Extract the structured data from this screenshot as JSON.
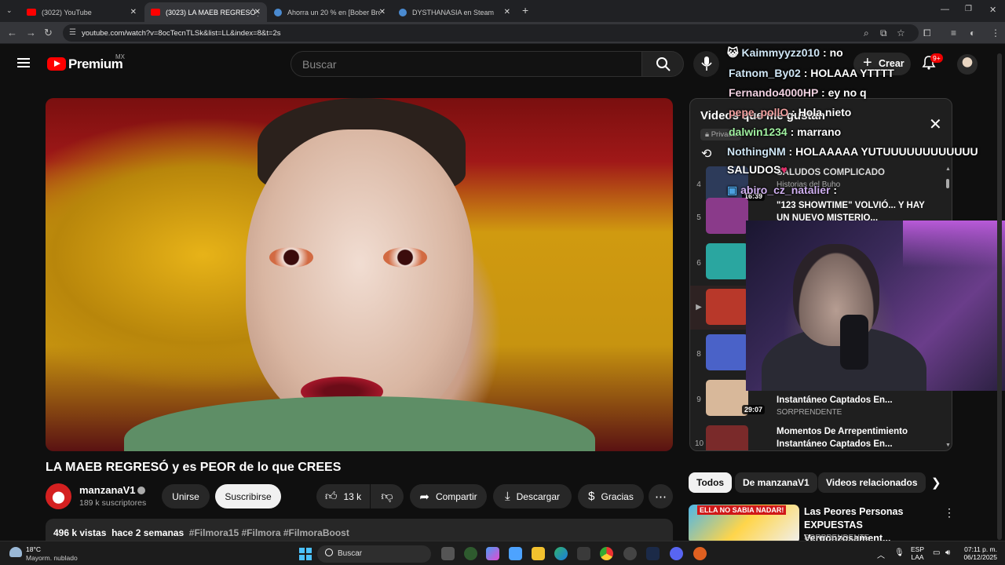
{
  "browser": {
    "tabs": [
      {
        "title": "(3022) YouTube",
        "icon": "youtube-icon"
      },
      {
        "title": "(3023) LA MAEB REGRESÓ y es",
        "icon": "youtube-icon"
      },
      {
        "title": "Ahorra un 20 % en [Bober Bros]",
        "icon": "steam-icon"
      },
      {
        "title": "DYSTHANASIA en Steam",
        "icon": "steam-icon"
      }
    ],
    "url": "youtube.com/watch?v=8ocTecnTLSk&list=LL&index=8&t=2s"
  },
  "header": {
    "logo_text": "Premium",
    "logo_region": "MX",
    "search_placeholder": "Buscar",
    "create_label": "Crear",
    "notifications_badge": "9+"
  },
  "video": {
    "title": "LA MAEB REGRESÓ y es PEOR de lo que CREES",
    "channel": "manzanaV1",
    "subscribers": "189 k suscriptores",
    "join_label": "Unirse",
    "subscribe_label": "Suscribirse",
    "likes": "13 k",
    "share_label": "Compartir",
    "download_label": "Descargar",
    "thanks_label": "Gracias",
    "views": "496 k vistas",
    "age": "hace 2 semanas",
    "tags": "#Filmora15 #Filmora #FilmoraBoost"
  },
  "playlist": {
    "title": "Videos que me gustan",
    "privacy": "Privada",
    "rows": [
      {
        "num": "4",
        "title": "SALUDOS COMPLICADO",
        "channel": "Historias del Buho",
        "duration": "16:39",
        "color": "#2d3b5a"
      },
      {
        "num": "5",
        "title": "\"123 SHOWTIME\" VOLVIÓ... Y HAY UN NUEVO MISTERIO...",
        "channel": "",
        "duration": "",
        "color": "#8a3a8a"
      },
      {
        "num": "6",
        "title": "",
        "channel": "",
        "duration": "",
        "color": "#2aa6a0"
      },
      {
        "num": "",
        "title": "",
        "channel": "",
        "duration": "",
        "color": "#b8382a"
      },
      {
        "num": "8",
        "title": "",
        "channel": "",
        "duration": "",
        "color": "#4a62c8"
      },
      {
        "num": "9",
        "title": "Instantáneo Captados En...",
        "channel": "SORPRENDENTE",
        "duration": "29:07",
        "color": "#d8b89a"
      },
      {
        "num": "10",
        "title": "Momentos De Arrepentimiento Instantáneo Captados En...",
        "channel": "",
        "duration": "",
        "color": "#7a2a2a"
      }
    ]
  },
  "chat": [
    {
      "user": "Kaimmyyzz010",
      "msg": "no"
    },
    {
      "user": "Fatnom_By02",
      "msg": "HOLAAA YTTTT"
    },
    {
      "user": "Fernando4000HP",
      "msg": "ey no q"
    },
    {
      "user": "pepe_pollO",
      "msg": "Hola nieto"
    },
    {
      "user": "dalwin1234",
      "msg": "marrano"
    },
    {
      "user": "NothingNM",
      "msg": "HOLAAAAA YUTUUUUUUUUUUUU"
    },
    {
      "user": "",
      "msg": "SALUDOS"
    },
    {
      "user": "abiro_cz_natalier",
      "msg": ""
    }
  ],
  "chips": [
    "Todos",
    "De manzanaV1",
    "Videos relacionados"
  ],
  "related": {
    "thumb_text": "ELLA NO SABIA NADAR!",
    "title": "Las Peores Personas EXPUESTAS Vergonzosament...",
    "channel": "SORPRENDENTE"
  },
  "taskbar": {
    "temp": "18°C",
    "weather": "Mayorm. nublado",
    "search_label": "Buscar",
    "lang1": "ESP",
    "lang2": "LAA",
    "time": "07:11 p. m.",
    "date": "06/12/2025"
  }
}
